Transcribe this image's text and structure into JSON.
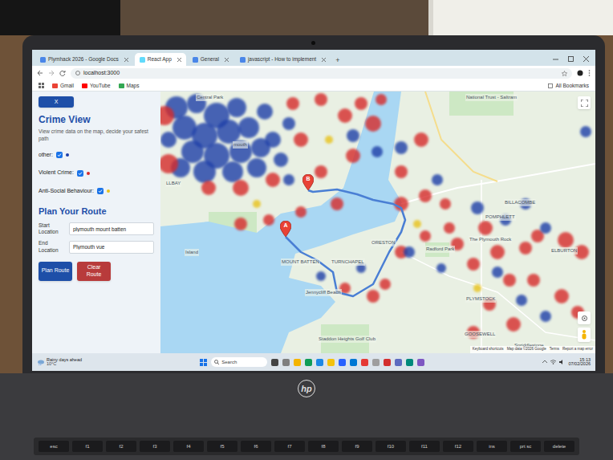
{
  "browser": {
    "tabs": [
      {
        "label": "Plymhack 2026 - Google Docs",
        "selected": false
      },
      {
        "label": "React App",
        "selected": true
      },
      {
        "label": "General",
        "selected": false
      },
      {
        "label": "javascript - How to implement",
        "selected": false
      }
    ],
    "new_tab": "+",
    "address": "localhost:3000",
    "bookmarks": [
      "Gmail",
      "YouTube",
      "Maps"
    ],
    "all_bookmarks": "All Bookmarks"
  },
  "sidebar": {
    "close": "X",
    "title": "Crime View",
    "subtitle": "View crime data on the map, decide your safest path",
    "filters": [
      {
        "label": "other:",
        "checked": true,
        "color": "#1e3fa8"
      },
      {
        "label": "Violent Crime:",
        "checked": true,
        "color": "#d62b2b"
      },
      {
        "label": "Anti-Social Behaviour:",
        "checked": true,
        "color": "#e8c21a"
      }
    ],
    "route_title": "Plan Your Route",
    "fields": [
      {
        "label": "Start Location",
        "value": "plymouth mount batten"
      },
      {
        "label": "End Location",
        "value": "Plymouth vue"
      }
    ],
    "buttons": [
      {
        "label": "Plan Route",
        "color": "#1e4fa8"
      },
      {
        "label": "Clear Route",
        "color": "#b83b3b"
      }
    ]
  },
  "map": {
    "places": [
      "Central Park",
      "National Trust - Saltram",
      "mouth",
      "LLBAY",
      "Island",
      "MOUNT BATTEN",
      "TURNCHAPEL",
      "ORESTON",
      "Radford Park",
      "The Plymouth Rock",
      "BILLACOMBE",
      "POMPHLETT",
      "ELBURTON",
      "PLYMSTOCK",
      "Jennycliff Beach",
      "GOOSEWELL",
      "Staddon Heights Golf Club",
      "Spriddlestone"
    ],
    "markers": [
      "A",
      "B"
    ],
    "attribution": [
      "Keyboard shortcuts",
      "Map data ©2026 Google",
      "Terms",
      "Report a map error"
    ]
  },
  "taskbar": {
    "weather": "Rainy days ahead",
    "temperature": "10°C",
    "search": "Search",
    "time": "15:13",
    "date": "07/02/2026"
  },
  "laptop": {
    "logo": "hp",
    "keys": [
      "esc",
      "f1",
      "f2",
      "f3",
      "f4",
      "f5",
      "f6",
      "f7",
      "f8",
      "f9",
      "f10",
      "f11",
      "f12",
      "ins",
      "prt sc",
      "delete"
    ]
  }
}
